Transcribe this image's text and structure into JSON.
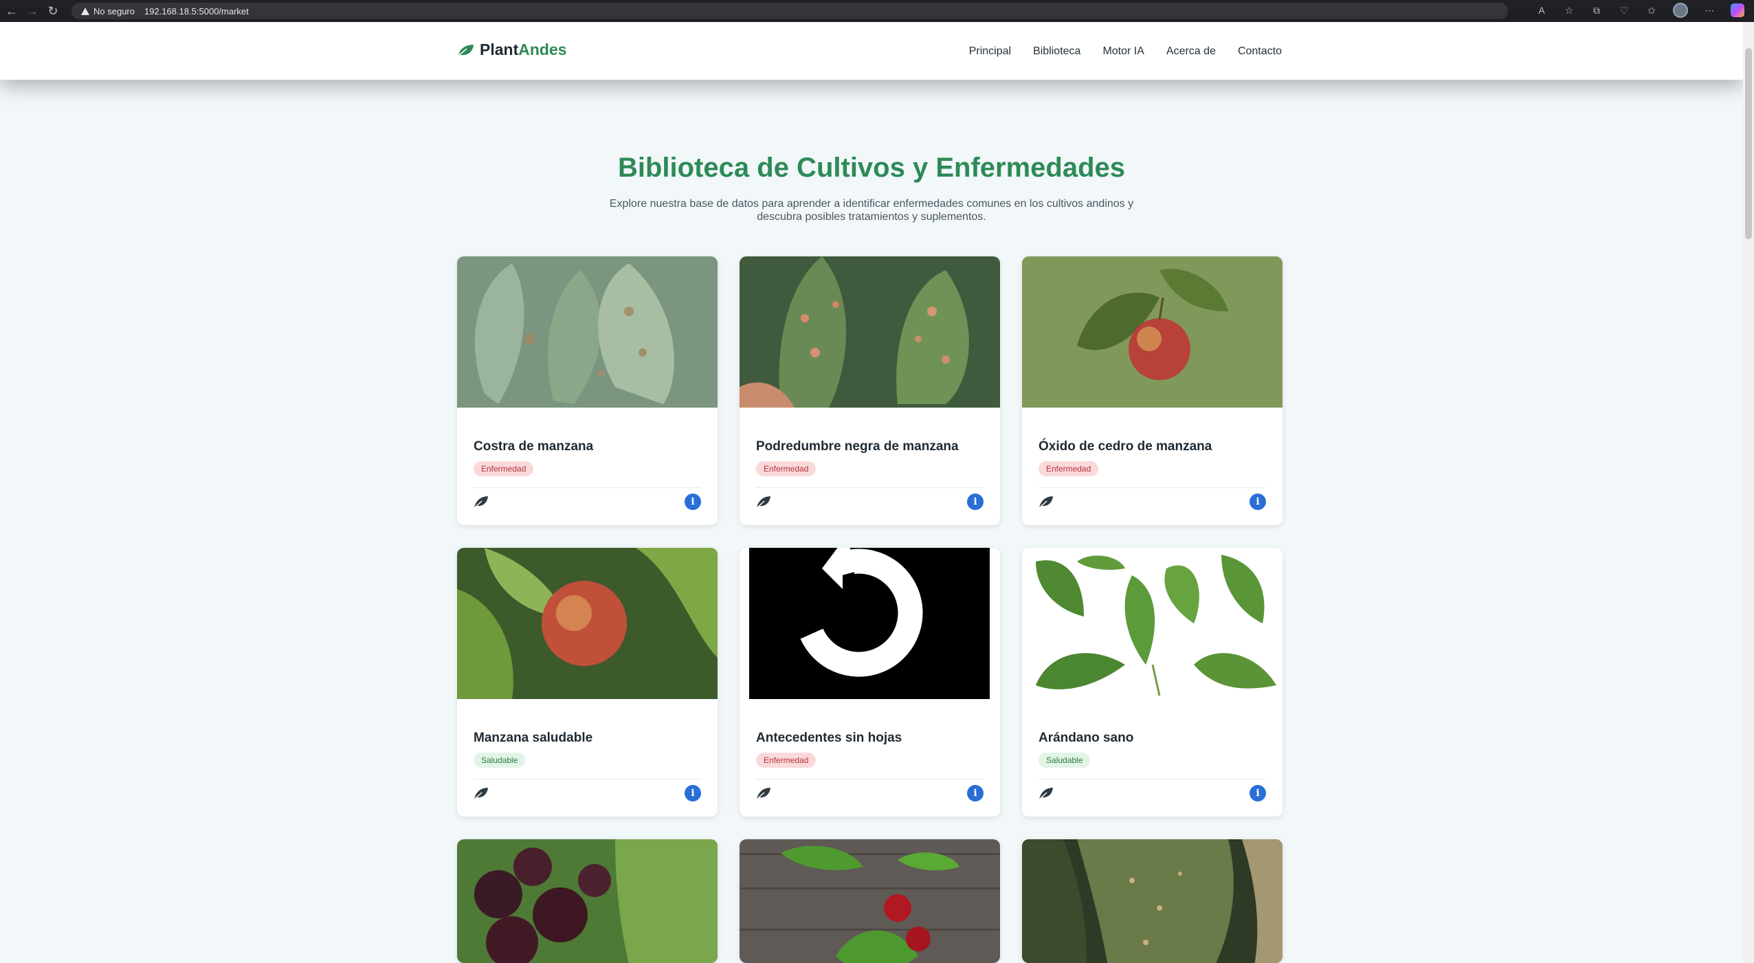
{
  "browser": {
    "security_label": "No seguro",
    "url": "192.168.18.5:5000/market"
  },
  "header": {
    "logo_part1": "Plant",
    "logo_part2": "Andes",
    "nav": [
      "Principal",
      "Biblioteca",
      "Motor IA",
      "Acerca de",
      "Contacto"
    ]
  },
  "main": {
    "title": "Biblioteca de Cultivos y Enfermedades",
    "subtitle": "Explore nuestra base de datos para aprender a identificar enfermedades comunes en los cultivos andinos y descubra posibles tratamientos y suplementos."
  },
  "cards": [
    {
      "title": "Costra de manzana",
      "badge": "Enfermedad",
      "status": "disease",
      "image": "apple-scab-leaves"
    },
    {
      "title": "Podredumbre negra de manzana",
      "badge": "Enfermedad",
      "status": "disease",
      "image": "black-rot-leaves"
    },
    {
      "title": "Óxido de cedro de manzana",
      "badge": "Enfermedad",
      "status": "disease",
      "image": "apple-on-branch"
    },
    {
      "title": "Manzana saludable",
      "badge": "Saludable",
      "status": "healthy",
      "image": "healthy-apple"
    },
    {
      "title": "Antecedentes sin hojas",
      "badge": "Enfermedad",
      "status": "disease",
      "image": "loading-placeholder"
    },
    {
      "title": "Arándano sano",
      "badge": "Saludable",
      "status": "healthy",
      "image": "blueberry-leaves"
    },
    {
      "title": "",
      "badge": "",
      "status": "",
      "image": "cherries-on-branch"
    },
    {
      "title": "",
      "badge": "",
      "status": "",
      "image": "cherries-on-wood"
    },
    {
      "title": "",
      "badge": "",
      "status": "",
      "image": "corn-leaf-spots"
    }
  ],
  "colors": {
    "brand_green": "#2d8a57",
    "info_blue": "#2a6fd6",
    "disease_badge_bg": "#fad9db",
    "healthy_badge_bg": "#e2f4e6"
  }
}
